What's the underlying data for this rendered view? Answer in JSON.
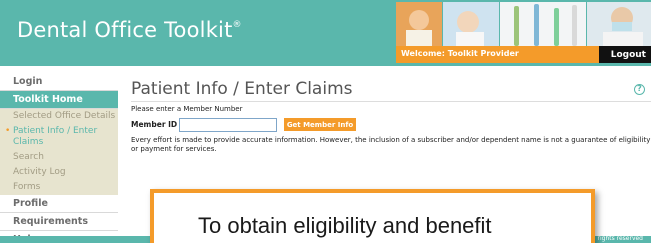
{
  "header": {
    "app_title": "Dental Office Toolkit",
    "trademark": "®",
    "welcome_text": "Welcome: Toolkit Provider",
    "logout_label": "Logout"
  },
  "sidebar": {
    "items": [
      {
        "label": "Login"
      },
      {
        "label": "Toolkit Home"
      },
      {
        "label": "Selected Office Details"
      },
      {
        "label": "Patient Info / Enter Claims"
      },
      {
        "label": "Search"
      },
      {
        "label": "Activity Log"
      },
      {
        "label": "Forms"
      },
      {
        "label": "Profile"
      },
      {
        "label": "Requirements"
      },
      {
        "label": "Help"
      }
    ]
  },
  "main": {
    "page_title": "Patient Info / Enter Claims",
    "help_icon_glyph": "?",
    "prompt": "Please enter a Member Number",
    "member_label": "Member ID",
    "member_value": "",
    "get_button_label": "Get Member Info",
    "disclaimer": "Every effort is made to provide accurate information. However, the inclusion of a subscriber and/or dependent name is not a guarantee of eligibility or payment for services."
  },
  "footer": {
    "text": "rights reserved"
  },
  "callout": {
    "text": "To obtain eligibility and benefit"
  },
  "colors": {
    "teal": "#5ab7ac",
    "orange": "#f49b2a",
    "sidebar_sub_bg": "#e7e4cf"
  },
  "icons": {
    "help": "help-icon",
    "photos": "header-photo-strip"
  }
}
